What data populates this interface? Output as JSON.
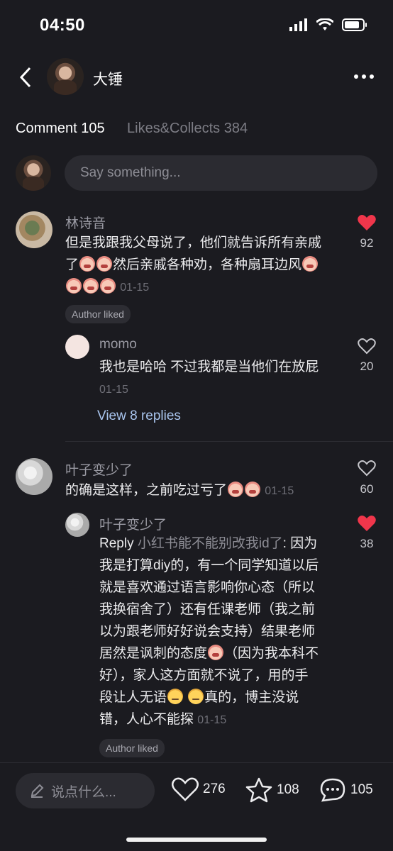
{
  "status_bar": {
    "time": "04:50"
  },
  "header": {
    "username": "大锤"
  },
  "tabs": [
    {
      "label": "Comment 105"
    },
    {
      "label": "Likes&Collects 384"
    }
  ],
  "composer": {
    "placeholder": "Say something..."
  },
  "comments": [
    {
      "user": "林诗音",
      "text_line1": "但是我跟我父母说了，他们就告诉所有亲戚",
      "text_line2_pre": "了",
      "text_line2_post": "然后亲戚各种劝，各种扇耳边风",
      "date": "01-15",
      "likes": "92",
      "liked": true,
      "badge": "Author liked",
      "reply": {
        "user": "momo",
        "text": "我也是哈哈 不过我都是当他们在放屁",
        "date": "01-15",
        "likes": "20",
        "liked": false
      },
      "view_replies": "View 8 replies"
    },
    {
      "user": "叶子变少了",
      "text": "的确是这样，之前吃过亏了",
      "date": "01-15",
      "likes": "60",
      "liked": false,
      "reply": {
        "user": "叶子变少了",
        "reply_prefix": "Reply",
        "reply_target": "小红书能不能别改我id了",
        "lines": [
          ": 因为",
          "我是打算diy的，有一个同学知道以后",
          "就是喜欢通过语言影响你心态（所以",
          "我换宿舍了）还有任课老师（我之前",
          "以为跟老师好好说会支持）结果老师",
          "居然是讽刺的态度",
          "（因为我本科不",
          "好），家人这方面就不说了，用的手",
          "段让人无语",
          "真的，博主没说",
          "错，人心不能探"
        ],
        "date": "01-15",
        "likes": "38",
        "liked": true,
        "badge": "Author liked"
      }
    }
  ],
  "bottom_bar": {
    "input_placeholder": "说点什么...",
    "likes": "276",
    "collects": "108",
    "comments": "105"
  },
  "colors": {
    "like_red": "#f0364b",
    "background": "#1b1b20"
  }
}
